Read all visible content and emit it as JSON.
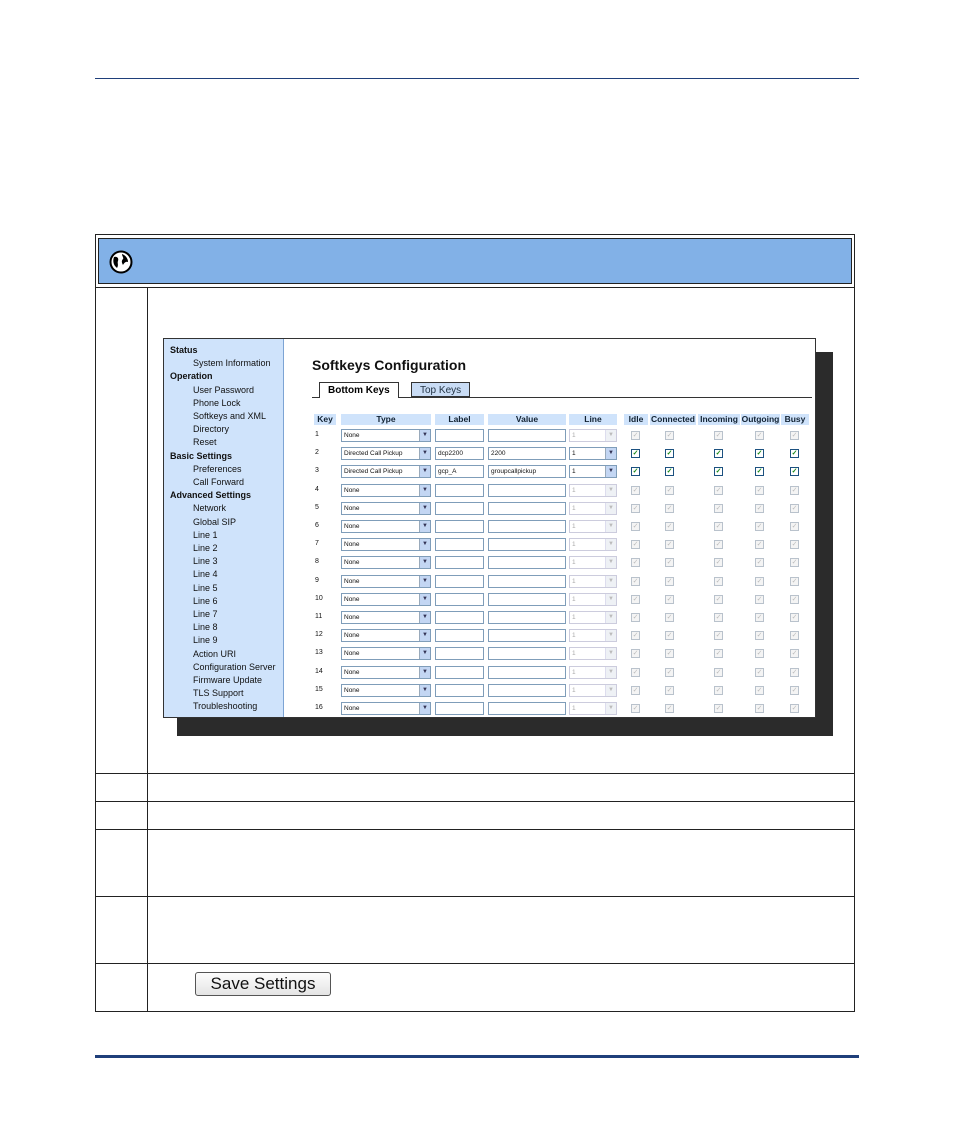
{
  "header": {
    "icon": "globe-icon",
    "band_color": "#82b1e7"
  },
  "nav": {
    "sections": [
      {
        "title": "Status",
        "items": [
          "System Information"
        ]
      },
      {
        "title": "Operation",
        "items": [
          "User Password",
          "Phone Lock",
          "Softkeys and XML",
          "Directory",
          "Reset"
        ]
      },
      {
        "title": "Basic Settings",
        "items": [
          "Preferences",
          "Call Forward"
        ]
      },
      {
        "title": "Advanced Settings",
        "items": [
          "Network",
          "Global SIP",
          "Line 1",
          "Line 2",
          "Line 3",
          "Line 4",
          "Line 5",
          "Line 6",
          "Line 7",
          "Line 8",
          "Line 9",
          "Action URI",
          "Configuration Server",
          "Firmware Update",
          "TLS Support",
          "Troubleshooting"
        ]
      }
    ]
  },
  "config": {
    "title": "Softkeys Configuration",
    "tabs": [
      "Bottom Keys",
      "Top Keys"
    ],
    "active_tab": "Bottom Keys",
    "columns": [
      "Key",
      "Type",
      "Label",
      "Value",
      "Line",
      "Idle",
      "Connected",
      "Incoming",
      "Outgoing",
      "Busy"
    ],
    "rows": [
      {
        "key": "1",
        "type": "None",
        "label": "",
        "value": "",
        "line": "1",
        "states": [
          false,
          false,
          false,
          false,
          false
        ],
        "enabled": false
      },
      {
        "key": "2",
        "type": "Directed Call Pickup",
        "label": "dcp2200",
        "value": "2200",
        "line": "1",
        "states": [
          true,
          true,
          true,
          true,
          true
        ],
        "enabled": true
      },
      {
        "key": "3",
        "type": "Directed Call Pickup",
        "label": "gcp_A",
        "value": "groupcallpickup",
        "line": "1",
        "states": [
          true,
          true,
          true,
          true,
          true
        ],
        "enabled": true
      },
      {
        "key": "4",
        "type": "None",
        "label": "",
        "value": "",
        "line": "1",
        "states": [
          false,
          false,
          false,
          false,
          false
        ],
        "enabled": false
      },
      {
        "key": "5",
        "type": "None",
        "label": "",
        "value": "",
        "line": "1",
        "states": [
          false,
          false,
          false,
          false,
          false
        ],
        "enabled": false
      },
      {
        "key": "6",
        "type": "None",
        "label": "",
        "value": "",
        "line": "1",
        "states": [
          false,
          false,
          false,
          false,
          false
        ],
        "enabled": false
      },
      {
        "key": "7",
        "type": "None",
        "label": "",
        "value": "",
        "line": "1",
        "states": [
          false,
          false,
          false,
          false,
          false
        ],
        "enabled": false
      },
      {
        "key": "8",
        "type": "None",
        "label": "",
        "value": "",
        "line": "1",
        "states": [
          false,
          false,
          false,
          false,
          false
        ],
        "enabled": false
      },
      {
        "key": "9",
        "type": "None",
        "label": "",
        "value": "",
        "line": "1",
        "states": [
          false,
          false,
          false,
          false,
          false
        ],
        "enabled": false
      },
      {
        "key": "10",
        "type": "None",
        "label": "",
        "value": "",
        "line": "1",
        "states": [
          false,
          false,
          false,
          false,
          false
        ],
        "enabled": false
      },
      {
        "key": "11",
        "type": "None",
        "label": "",
        "value": "",
        "line": "1",
        "states": [
          false,
          false,
          false,
          false,
          false
        ],
        "enabled": false
      },
      {
        "key": "12",
        "type": "None",
        "label": "",
        "value": "",
        "line": "1",
        "states": [
          false,
          false,
          false,
          false,
          false
        ],
        "enabled": false
      },
      {
        "key": "13",
        "type": "None",
        "label": "",
        "value": "",
        "line": "1",
        "states": [
          false,
          false,
          false,
          false,
          false
        ],
        "enabled": false
      },
      {
        "key": "14",
        "type": "None",
        "label": "",
        "value": "",
        "line": "1",
        "states": [
          false,
          false,
          false,
          false,
          false
        ],
        "enabled": false
      },
      {
        "key": "15",
        "type": "None",
        "label": "",
        "value": "",
        "line": "1",
        "states": [
          false,
          false,
          false,
          false,
          false
        ],
        "enabled": false
      },
      {
        "key": "16",
        "type": "None",
        "label": "",
        "value": "",
        "line": "1",
        "states": [
          false,
          false,
          false,
          false,
          false
        ],
        "enabled": false
      }
    ]
  },
  "save_button": {
    "label": "Save Settings"
  }
}
